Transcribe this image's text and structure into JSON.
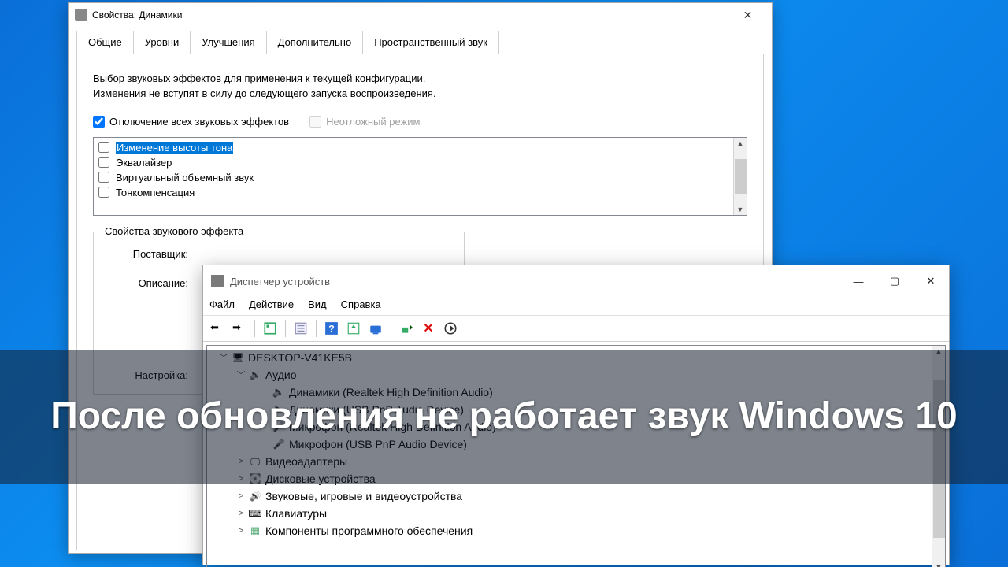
{
  "props": {
    "title": "Свойства: Динамики",
    "tabs": [
      "Общие",
      "Уровни",
      "Улучшения",
      "Дополнительно",
      "Пространственный звук"
    ],
    "active_tab": 2,
    "description": "Выбор звуковых эффектов для применения к текущей конфигурации. Изменения не вступят в силу до следующего запуска воспроизведения.",
    "disable_all": {
      "label": "Отключение всех звуковых эффектов",
      "checked": true
    },
    "immediate": {
      "label": "Неотложный режим",
      "checked": false
    },
    "effects": [
      {
        "label": "Изменение высоты тона",
        "checked": false,
        "selected": true
      },
      {
        "label": "Эквалайзер",
        "checked": false
      },
      {
        "label": "Виртуальный объемный звук",
        "checked": false
      },
      {
        "label": "Тонкомпенсация",
        "checked": false
      }
    ],
    "group_title": "Свойства звукового эффекта",
    "fields": {
      "provider": "Поставщик:",
      "desc": "Описание:",
      "setting": "Настройка:"
    }
  },
  "dm": {
    "title": "Диспетчер устройств",
    "menu": [
      "Файл",
      "Действие",
      "Вид",
      "Справка"
    ],
    "root": "DESKTOP-V41KE5B",
    "audio_cat": "Аудио",
    "audio_children": [
      {
        "icon": "speaker",
        "label": "Динамики (Realtek High Definition Audio)"
      },
      {
        "icon": "speaker",
        "label": "Динамики (USB PnP Audio Device)"
      },
      {
        "icon": "mic",
        "label": "Микрофон (Realtek High Definition Audio)"
      },
      {
        "icon": "mic",
        "label": "Микрофон (USB PnP Audio Device)"
      }
    ],
    "siblings": [
      {
        "icon": "vid",
        "label": "Видеоадаптеры"
      },
      {
        "icon": "disk",
        "label": "Дисковые устройства"
      },
      {
        "icon": "sound",
        "label": "Звуковые, игровые и видеоустройства"
      },
      {
        "icon": "kbd",
        "label": "Клавиатуры"
      },
      {
        "icon": "chip",
        "label": "Компоненты программного обеспечения"
      }
    ]
  },
  "headline": "После обновления не работает звук Windows 10"
}
